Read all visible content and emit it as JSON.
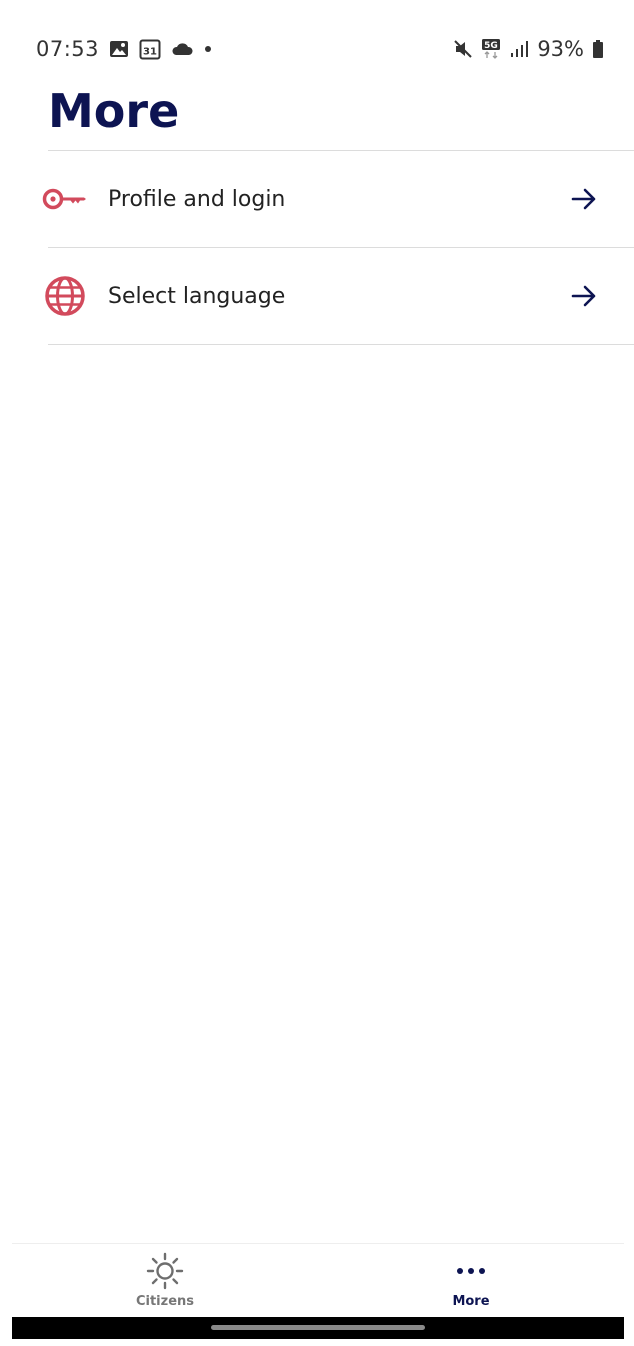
{
  "status_bar": {
    "time": "07:53",
    "calendar_day": "31",
    "network_type": "5G",
    "battery": "93%",
    "left_icons": [
      "image-icon",
      "calendar-icon",
      "cloud-icon",
      "dot-icon"
    ],
    "right_icons": [
      "mute-icon",
      "5g-icon",
      "signal-icon",
      "battery-icon"
    ]
  },
  "header": {
    "title": "More"
  },
  "menu": {
    "items": [
      {
        "label": "Profile and login",
        "icon": "key-icon"
      },
      {
        "label": "Select language",
        "icon": "globe-icon"
      }
    ],
    "arrow_icon": "arrow-right-icon"
  },
  "bottom_nav": {
    "tabs": [
      {
        "label": "Citizens",
        "icon": "sun-icon",
        "active": false
      },
      {
        "label": "More",
        "icon": "more-dots-icon",
        "active": true
      }
    ]
  },
  "colors": {
    "primary_navy": "#0d1452",
    "accent_red": "#d24a5c",
    "inactive_gray": "#777777",
    "divider": "#dcdcdc"
  }
}
